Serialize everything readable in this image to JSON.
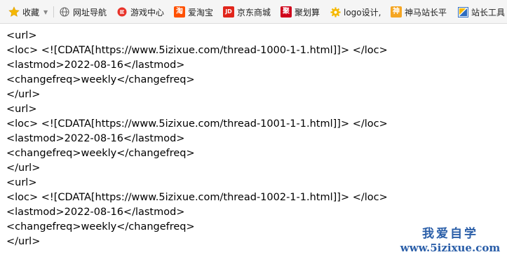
{
  "bookmarks": {
    "favorites": "收藏",
    "items": [
      {
        "label": "网址导航",
        "icon": "globe-icon"
      },
      {
        "label": "游戏中心",
        "icon": "game-icon"
      },
      {
        "label": "爱淘宝",
        "icon": "taobao-icon",
        "badge": "淘",
        "color": "#ff5000"
      },
      {
        "label": "京东商城",
        "icon": "jd-icon",
        "badge": "JD",
        "color": "#e1251b"
      },
      {
        "label": "聚划算",
        "icon": "juhuasuan-icon",
        "badge": "聚",
        "color": "#d0021b"
      },
      {
        "label": "logo设计,",
        "icon": "gear-icon"
      },
      {
        "label": "神马站长平",
        "icon": "shenma-icon",
        "badge": "神",
        "color": "#f5a623"
      },
      {
        "label": "站长工具",
        "icon": "chinaz-icon"
      }
    ]
  },
  "xml_lines": [
    "<url>",
    "<loc> <![CDATA[https://www.5izixue.com/thread-1000-1-1.html]]> </loc>",
    "<lastmod>2022-08-16</lastmod>",
    "<changefreq>weekly</changefreq>",
    "</url>",
    "<url>",
    "<loc> <![CDATA[https://www.5izixue.com/thread-1001-1-1.html]]> </loc>",
    "<lastmod>2022-08-16</lastmod>",
    "<changefreq>weekly</changefreq>",
    "</url>",
    "<url>",
    "<loc> <![CDATA[https://www.5izixue.com/thread-1002-1-1.html]]> </loc>",
    "<lastmod>2022-08-16</lastmod>",
    "<changefreq>weekly</changefreq>",
    "</url>"
  ],
  "watermark": {
    "title": "我爱自学",
    "url": "www.5izixue.com"
  }
}
